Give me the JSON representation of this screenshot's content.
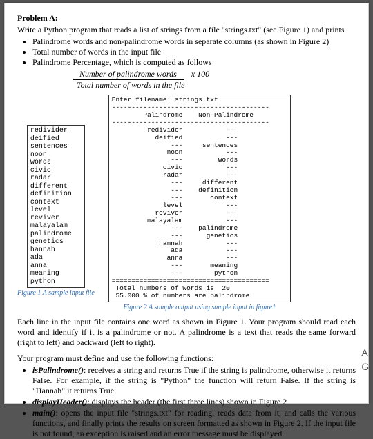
{
  "heading": "Problem A:",
  "intro": "Write a Python program that reads a list of strings from a file \"strings.txt\" (see Figure 1) and prints",
  "bullets": [
    "Palindrome words and non-palindrome words in separate columns (as shown in Figure 2)",
    "Total number of words in the input file",
    "Palindrome Percentage, which is computed as follows"
  ],
  "formula": {
    "top": "Number of palindrome words",
    "x100": "x  100",
    "bottom": "Total number of words in the file"
  },
  "fig1": {
    "lines": "redivider\ndeified\nsentences\nnoon\nwords\ncivic\nradar\ndifferent\ndefinition\ncontext\nlevel\nreviver\nmalayalam\npalindrome\ngenetics\nhannah\nada\nanna\nmeaning\npython",
    "caption": "Figure 1 A sample input file"
  },
  "fig2": {
    "output": "Enter filename: strings.txt\n----------------------------------------\n        Palindrome    Non-Palindrome\n----------------------------------------\n         redivider           ---\n           deified           ---\n               ---     sentences\n              noon           ---\n               ---         words\n             civic           ---\n             radar           ---\n               ---     different\n               ---    definition\n               ---       context\n             level           ---\n           reviver           ---\n         malayalam           ---\n               ---    palindrome\n               ---      genetics\n            hannah           ---\n               ada           ---\n              anna           ---\n               ---       meaning\n               ---        python\n========================================\n Total numbers of words is  20\n 55.000 % of numbers are palindrome",
    "caption": "Figure 2 A sample output using sample input in figure1"
  },
  "body1": "Each line in the input file contains one word as shown in Figure 1. Your program should read each word and identify if it is a palindrome or not. A palindrome is a text that reads the same forward (right to left) and backward (left to right).",
  "body2": "Your program must define and use the following functions:",
  "funcs": [
    {
      "name": "isPalindrome()",
      "desc": ": receives a string and returns True if the string is palindrome, otherwise it returns False. For example, if the string is \"Python\" the function will return False. If the string is \"Hannah\" it returns True."
    },
    {
      "name": "displayHeader()",
      "desc": ": displays the header (the first three lines) shown in Figure 2"
    },
    {
      "name": "main()",
      "desc": ": opens the input file \"strings.txt\" for reading, reads data from it, and calls the various functions, and finally prints the results on screen formatted as shown in Figure 2. If the input file is not found, an exception is raised and an error message must be displayed."
    }
  ],
  "side": {
    "a": "A",
    "g": "Go"
  }
}
